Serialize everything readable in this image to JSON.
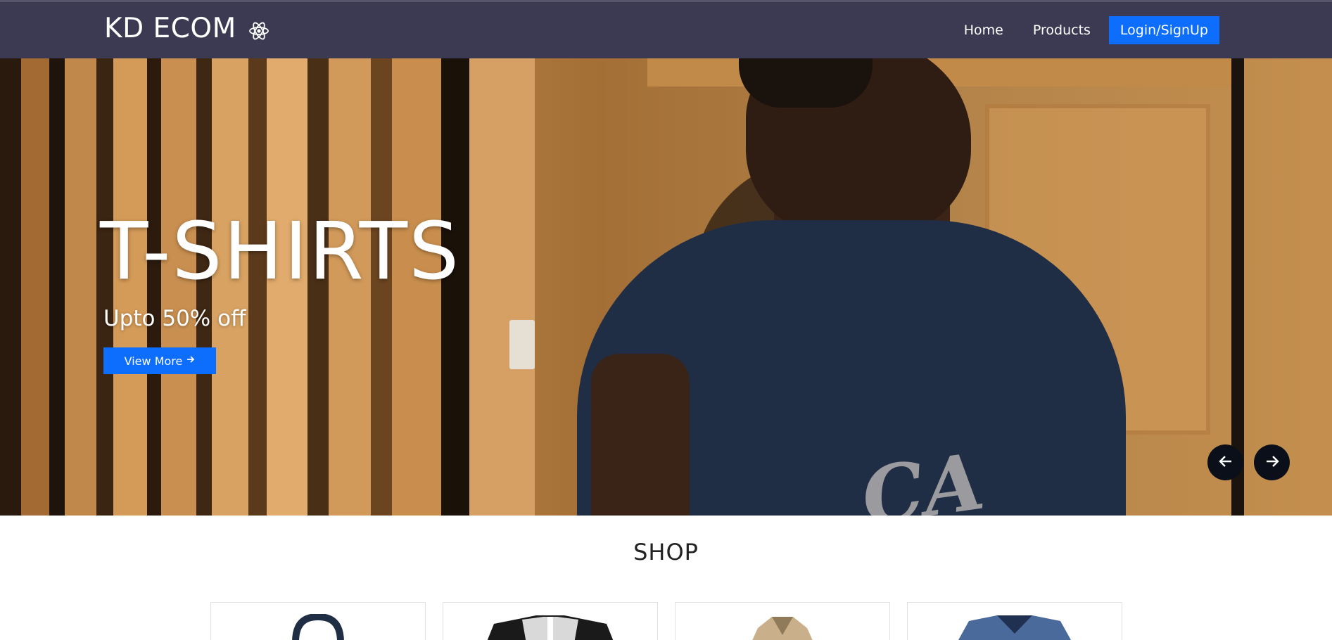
{
  "navbar": {
    "brand": "KD ECOM",
    "brand_icon": "react-atom-icon",
    "links": [
      {
        "label": "Home"
      },
      {
        "label": "Products"
      }
    ],
    "login_label": "Login/SignUp"
  },
  "hero": {
    "title": "T-SHIRTS",
    "subtitle": "Upto 50% off",
    "cta_label": "View More",
    "cta_icon": "arrow-right-icon",
    "shirt_logo": "CA",
    "prev_icon": "arrow-left-icon",
    "next_icon": "arrow-right-icon"
  },
  "shop": {
    "title": "SHOP",
    "products": [
      {
        "icon": "navy-polo-shirt-image",
        "color": "#1f2e45"
      },
      {
        "icon": "black-raglan-henley-image",
        "color": "#1a1a1a"
      },
      {
        "icon": "beige-jacket-image",
        "color": "#c9b08a"
      },
      {
        "icon": "blue-vneck-shirt-image",
        "color": "#4a6a9c"
      }
    ]
  },
  "colors": {
    "navbar_bg": "#3b3a52",
    "accent": "#0d6efd",
    "carousel_btn": "#0b0f1a"
  }
}
